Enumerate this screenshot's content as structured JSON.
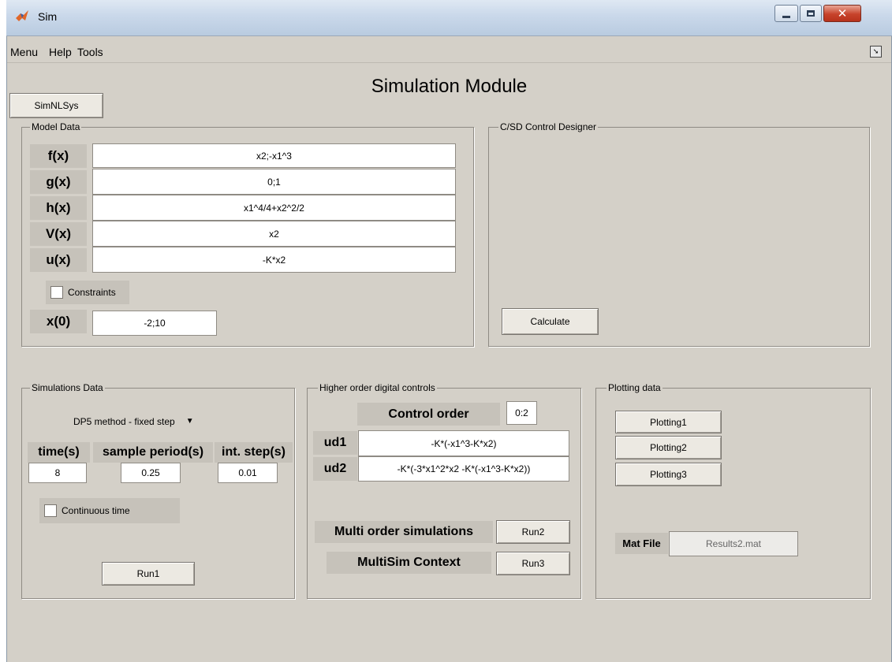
{
  "window": {
    "title": "Sim"
  },
  "menu": {
    "items": [
      "Menu",
      "Help",
      "Tools"
    ]
  },
  "page_title": "Simulation Module",
  "simnlsys_label": "SimNLSys",
  "model_data": {
    "title": "Model Data",
    "rows": [
      {
        "label": "f(x)",
        "value": "x2;-x1^3"
      },
      {
        "label": "g(x)",
        "value": "0;1"
      },
      {
        "label": "h(x)",
        "value": "x1^4/4+x2^2/2"
      },
      {
        "label": "V(x)",
        "value": "x2"
      },
      {
        "label": "u(x)",
        "value": "-K*x2"
      }
    ],
    "constraints_label": "Constraints",
    "x0_label": "x(0)",
    "x0_value": "-2;10"
  },
  "csd": {
    "title": "C/SD Control Designer",
    "calculate_label": "Calculate"
  },
  "simulations": {
    "title": "Simulations Data",
    "method": "DP5 method - fixed step",
    "time_label": "time(s)",
    "time_value": "8",
    "sample_label": "sample period(s)",
    "sample_value": "0.25",
    "step_label": "int. step(s)",
    "step_value": "0.01",
    "continuous_label": "Continuous time",
    "run1_label": "Run1"
  },
  "hodc": {
    "title": "Higher order digital controls",
    "order_label": "Control order",
    "order_value": "0:2",
    "ud1_label": "ud1",
    "ud1_value": "-K*(-x1^3-K*x2)",
    "ud2_label": "ud2",
    "ud2_value": "-K*(-3*x1^2*x2 -K*(-x1^3-K*x2))",
    "multi_label": "Multi order simulations",
    "run2_label": "Run2",
    "multisim_label": "MultiSim Context",
    "run3_label": "Run3"
  },
  "plotting": {
    "title": "Plotting data",
    "buttons": [
      "Plotting1",
      "Plotting2",
      "Plotting3"
    ],
    "matfile_label": "Mat File",
    "matfile_value": "Results2.mat"
  }
}
